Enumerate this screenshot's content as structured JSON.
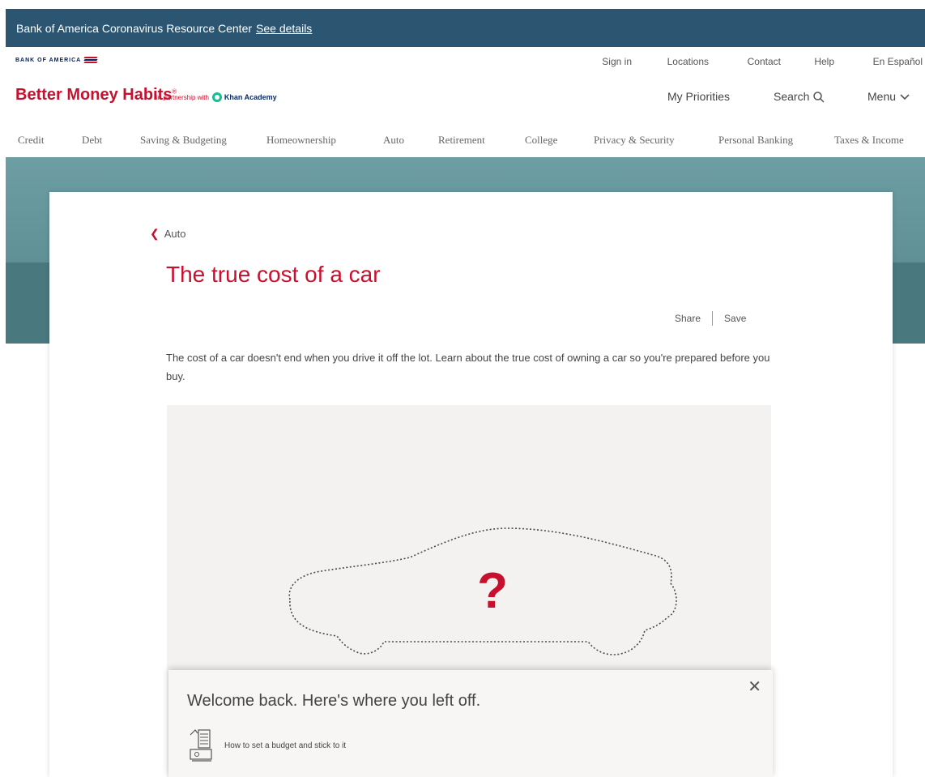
{
  "banner": {
    "text": "Bank of America Coronavirus Resource Center",
    "link": "See details"
  },
  "utility": {
    "logo_text": "BANK OF AMERICA",
    "sign_in": "Sign in",
    "locations": "Locations",
    "contact": "Contact",
    "help": "Help",
    "espanol": "En Español"
  },
  "brand": {
    "name": "Better Money Habits",
    "mark": "®",
    "partner_prefix": "in partnership with",
    "partner_name": "Khan Academy",
    "my_priorities": "My Priorities",
    "search": "Search",
    "menu": "Menu"
  },
  "categories": [
    "Credit",
    "Debt",
    "Saving & Budgeting",
    "Homeownership",
    "Auto",
    "Retirement",
    "College",
    "Privacy & Security",
    "Personal Banking",
    "Taxes & Income"
  ],
  "article": {
    "back_label": "Auto",
    "title": "The true cost of a car",
    "share": "Share",
    "save": "Save",
    "intro": "The cost of a car doesn't end when you drive it off the lot. Learn about the true cost of owning a car so you're prepared before you buy.",
    "illustration_mark": "?"
  },
  "popup": {
    "heading": "Welcome back. Here's where you left off.",
    "item_label": "How to set a budget and stick to it"
  },
  "colors": {
    "brand_red": "#c8102e",
    "banner_blue": "#2b5570",
    "hero_teal": "#5f9197",
    "khan_green": "#14bf96"
  },
  "icons": {
    "search": "search-icon",
    "menu": "chevron-down-icon",
    "back": "chevron-left-icon",
    "close": "close-icon",
    "item": "budget-icon"
  }
}
